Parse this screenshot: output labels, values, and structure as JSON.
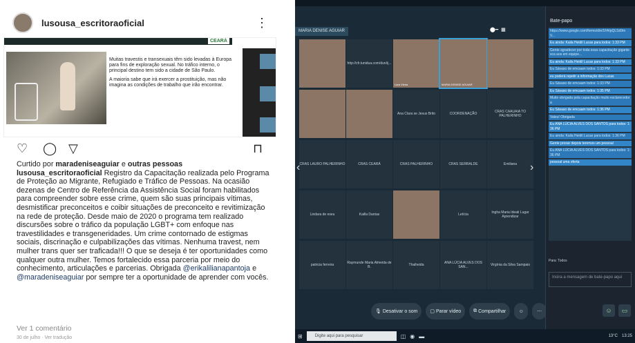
{
  "instagram": {
    "username": "lusousa_escritoraoficial",
    "more_icon": "⋮",
    "slide": {
      "brand": "CEARÁ",
      "para1": "Muitas travestis e transexuais têm sido levadas à Europa para fins de exploração sexual. No tráfico interno, o principal destino tem sido a cidade de São Paulo.",
      "para2": "A maioria sabe que irá exercer a prostituição, mas não imagina as condições de trabalho que irão encontrar."
    },
    "liked_prefix": "Curtido por ",
    "liked_user": "maradeniseaguiar",
    "liked_joiner": " e ",
    "liked_others": "outras pessoas",
    "caption_user": "lusousa_escritoraoficial",
    "caption_text": " Registro da Capacitação realizada pelo Programa de Proteção ao Migrante, Refugiado e Tráfico de Pessoas. Na ocasião dezenas de Centro de Referência da Assistência Social foram habilitados para compreender sobre esse crime, quem são suas principais vítimas, desmistificar preconceitos e coibir situações de preconceito e revitimização na rede de proteção. Desde maio de 2020 o programa tem realizado discursões sobre o tráfico da população LGBT+ com enfoque nas travestilidades e transgeneridades. Um crime contornado de estigmas sociais, discrinação e culpabilizações das vítimas. Nenhuma travest, nem mulher trans quer ser traficada!!! O que se deseja é ter oportunidades como qualquer outra mulher. Temos fortalecido essa parceria por meio do conhecimento, articulações e parcerias.  Obrigada ",
    "mention1": "@erikalilianapantoja",
    "mention_joiner": " e ",
    "mention2": "@maradeniseaguiar",
    "caption_end": " por sempre ter a oportunidade de aprender com vocês.",
    "comments": "Ver 1 comentário",
    "date": "30 de julho · Ver tradução"
  },
  "meeting": {
    "presenter_name": "MARIA DENISE AGUIAR",
    "tiles": [
      {
        "label": "",
        "video": true
      },
      {
        "label": "http://cfr.tunidua.com/dun/ij...",
        "video": false
      },
      {
        "label": "Lara Vieira",
        "video": true
      },
      {
        "label": "MARIA DENISE AGUIAR",
        "video": true,
        "active": true
      },
      {
        "label": "",
        "video": true
      },
      {
        "label": "",
        "video": true
      },
      {
        "label": "",
        "video": true
      },
      {
        "label": "Ana Clara se Jesus Brito",
        "video": false
      },
      {
        "label": "COORDENAÇÃO",
        "video": false
      },
      {
        "label": "CRAS CAAUAIA TO PALHERINHO",
        "video": false
      },
      {
        "label": "CRAS LAURO PALHERINHO",
        "video": false
      },
      {
        "label": "CRAS CEARÁ",
        "video": false
      },
      {
        "label": "CRAS PALHERINHO",
        "video": false
      },
      {
        "label": "CRAS SERRALDE",
        "video": false
      },
      {
        "label": "Emiliana",
        "video": false
      },
      {
        "label": "Lindara de eseu",
        "video": false
      },
      {
        "label": "Kailla Dantas",
        "video": false
      },
      {
        "label": "",
        "video": true
      },
      {
        "label": "Letícia",
        "video": false
      },
      {
        "label": "Ingha Maria Ideati Lugar Aprendizar",
        "video": false
      },
      {
        "label": "patricia ferreira",
        "video": false
      },
      {
        "label": "Raymunde Maria Almeida de B.",
        "video": false
      },
      {
        "label": "Thaiheida",
        "video": false
      },
      {
        "label": "ANA LÚCIA ALVES DOS SAN...",
        "video": false
      },
      {
        "label": "Virgínia da Silva Sampaio",
        "video": false
      }
    ],
    "toolbar": {
      "mute": "Desativar o som",
      "video": "Parar vídeo",
      "share": "Compartilhar"
    },
    "chat": {
      "title": "Bate-papo",
      "messages": [
        "https://www.google.com/forms/d/e/1FAIpQLSd9mV...",
        "Eu ainda: Kaila Heidil Lucas para todos:  1:33 PM",
        "Gente agradecer por toda essa capacitação gigantesca aos em equipe...",
        "Eu ainda: Kaila Heidil Lucas para todos:  1:33 PM",
        "Eu Sávaso de emcaam todos:  1:33 PM",
        "eu poderá repetir a informação dos Lucas",
        "Eu Sávaso de emcaam todos:  1:33 PM",
        "Eu Sávaso de emcaam todos:  1:35 PM",
        "Muito obrigada pela capacitação muito esclarecedora",
        "Eu Sávaso de emcaam todos:  1:36 PM",
        "Valeu! Obrigada",
        "Eu ANA LÚCIA ALVES DOS SANTOS para todos:  1:36 PM",
        "Eu ainda: Kaila Heidil Lucas para todos:  1:36 PM",
        "Gente prosar depois teremos um pessoal",
        "Eu ANA LÚCIA ALVES DOS SANTOS para todos:  1:36 PM",
        "pessoal uma oferta"
      ],
      "to_label": "Para:",
      "to_value": "Todos",
      "input_placeholder": "Insira a mensagem de bate-papo aqui"
    },
    "taskbar": {
      "search": "Digite aqui para pesquisar",
      "temp": "13°C",
      "time": "13:25"
    }
  },
  "colors": {
    "meeting_bg": "#1c2a35",
    "chat_highlight": "#2c78b8",
    "leave_red": "#e0352c"
  }
}
